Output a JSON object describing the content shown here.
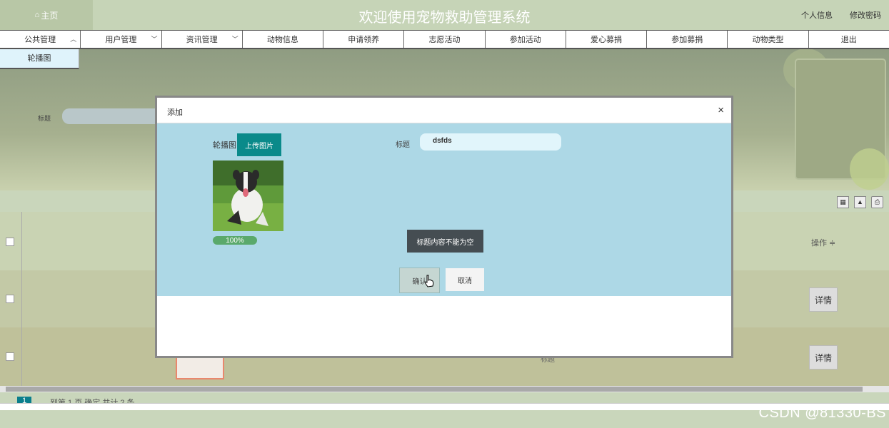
{
  "header": {
    "home_label": "主页",
    "title": "欢迎使用宠物救助管理系统",
    "profile_link": "个人信息",
    "change_password_link": "修改密码"
  },
  "nav": [
    {
      "label": "公共管理",
      "caret": "^"
    },
    {
      "label": "用户管理",
      "caret": "v"
    },
    {
      "label": "资讯管理",
      "caret": "v"
    },
    {
      "label": "动物信息"
    },
    {
      "label": "申请领养"
    },
    {
      "label": "志愿活动"
    },
    {
      "label": "参加活动"
    },
    {
      "label": "爱心募捐"
    },
    {
      "label": "参加募捐"
    },
    {
      "label": "动物类型"
    },
    {
      "label": "退出"
    }
  ],
  "submenu": {
    "item": "轮播图"
  },
  "search": {
    "label": "标题"
  },
  "table": {
    "op_header": "操作 ≑",
    "detail_label": "详情",
    "row2_fragment": "标题"
  },
  "pager": {
    "page": "1",
    "text": "到第 1 页 确定 共计 2 条"
  },
  "modal": {
    "title": "添加",
    "close": "×",
    "image_label": "轮播图",
    "upload_label": "上传图片",
    "progress": "100%",
    "title_label": "标题",
    "title_value": "dsfds",
    "toast": "标题内容不能为空",
    "confirm_label": "确认",
    "cancel_label": "取消"
  },
  "watermark": "CSDN @81330-BS",
  "colors": {
    "accent": "#0a8a8a",
    "modal_body": "#add8e6",
    "header": "#c6d4b7",
    "toast": "#454d52",
    "progress": "#5aa96b"
  }
}
